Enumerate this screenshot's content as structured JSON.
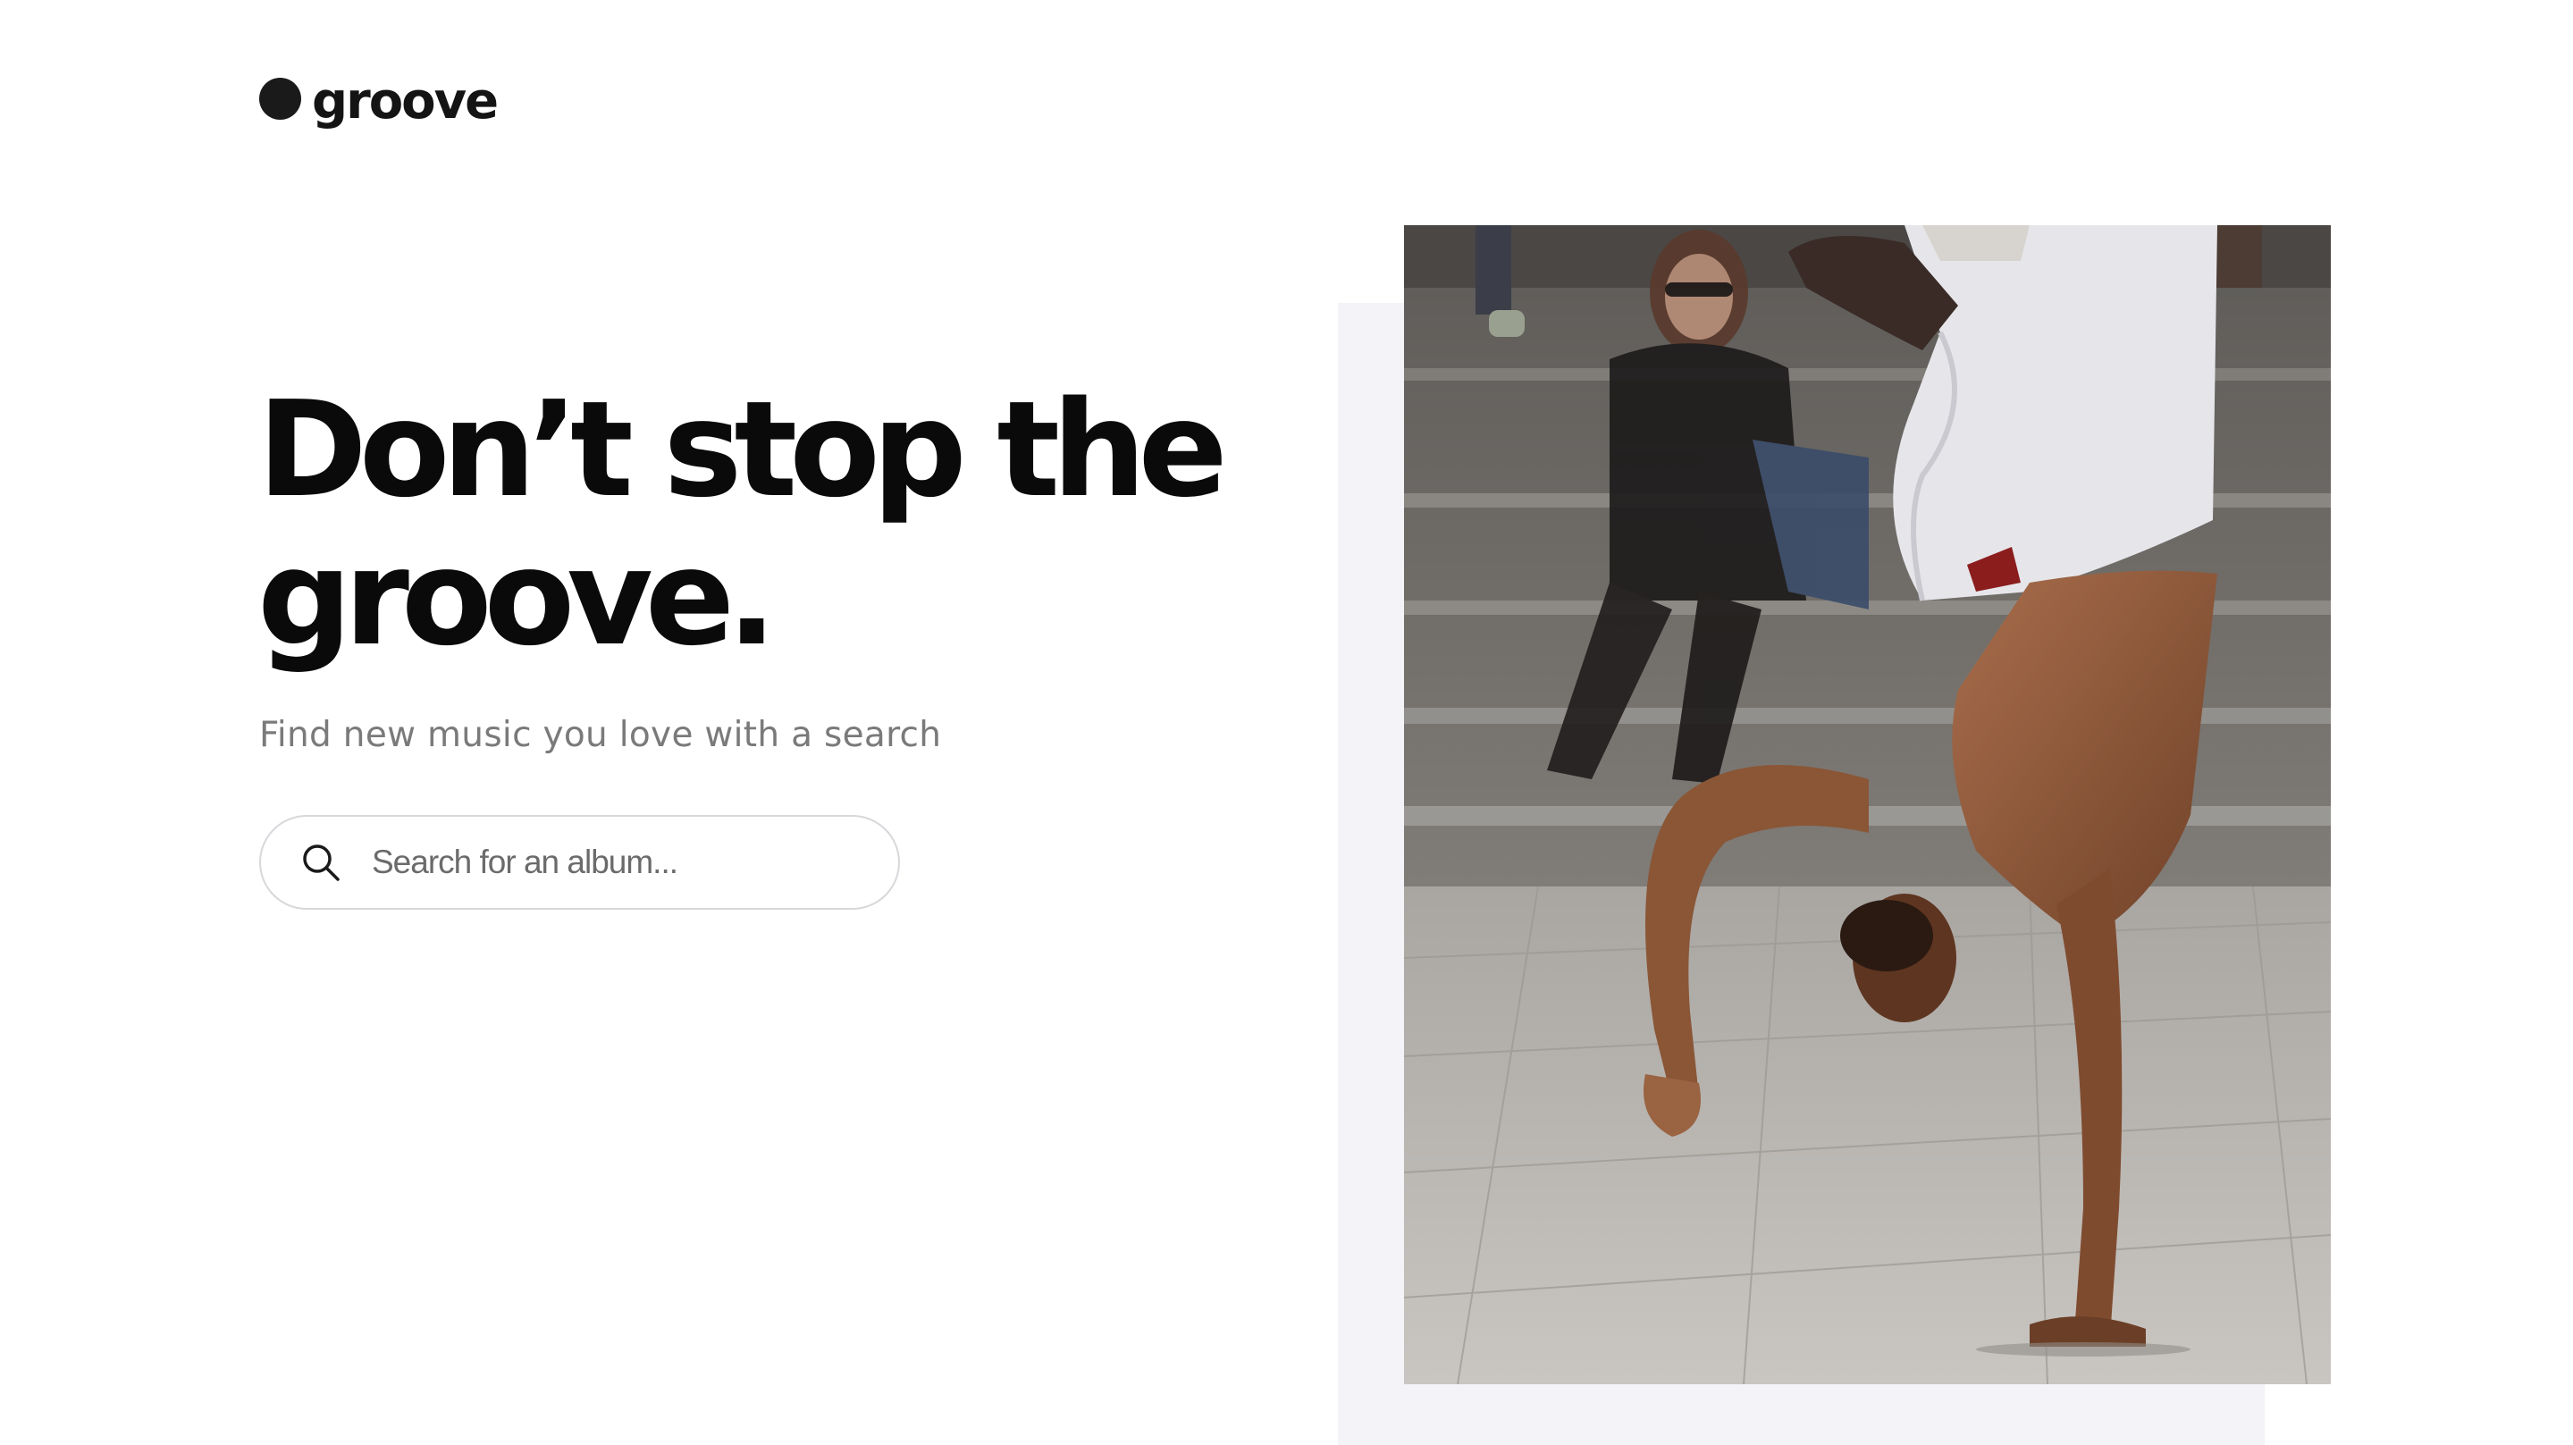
{
  "brand": {
    "name": "groove"
  },
  "hero": {
    "headline_line1": "Don’t stop the",
    "headline_line2": "groove.",
    "subtitle": "Find new music you love with a search"
  },
  "search": {
    "placeholder": "Search for an album...",
    "value": "",
    "icon": "search-icon"
  },
  "image": {
    "subject": "breakdancer-handstand-photo"
  },
  "colors": {
    "text_primary": "#0a0a0a",
    "text_secondary": "#7a7a7a",
    "input_border": "#d8d8dc",
    "backdrop": "#f3f3f8"
  }
}
